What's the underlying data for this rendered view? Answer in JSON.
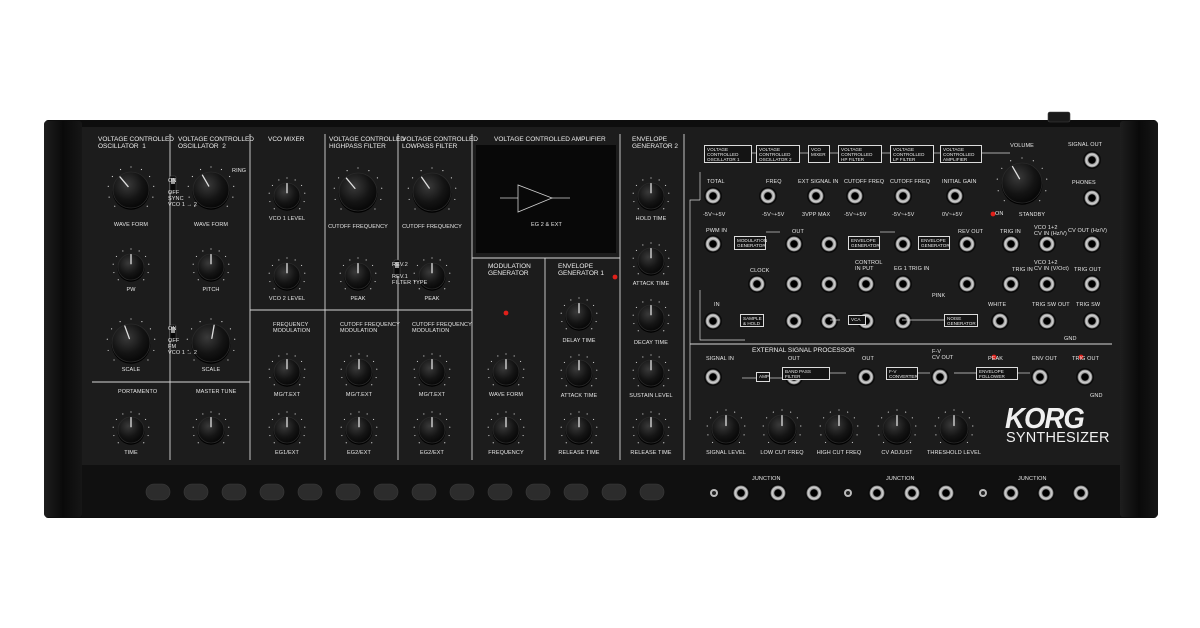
{
  "brand": {
    "logo": "KORG",
    "product": "SYNTHESIZER"
  },
  "sections": {
    "vco1": "VOLTAGE CONTROLLED\nOSCILLATOR  1",
    "vco2": "VOLTAGE CONTROLLED\nOSCILLATOR  2",
    "vco_mixer": "VCO MIXER",
    "hpf": "VOLTAGE CONTROLLED\nHIGHPASS FILTER",
    "lpf": "VOLTAGE CONTROLLED\nLOWPASS FILTER",
    "vca": "VOLTAGE CONTROLLED AMPLIFIER",
    "eg2": "ENVELOPE\nGENERATOR 2",
    "mod_gen": "MODULATION\nGENERATOR",
    "eg1": "ENVELOPE\nGENERATOR 1",
    "freq_mod": "FREQUENCY\nMODULATION",
    "cutoff_mod1": "CUTOFF FREQUENCY\nMODULATION",
    "cutoff_mod2": "CUTOFF FREQUENCY\nMODULATION",
    "esp": "EXTERNAL SIGNAL PROCESSOR",
    "portamento": "PORTAMENTO",
    "master_tune": "MASTER TUNE"
  },
  "knob_labels": {
    "vco1_wave": "WAVE FORM",
    "vco2_wave": "WAVE FORM",
    "pw": "PW",
    "pitch": "PITCH",
    "vco1_scale": "SCALE",
    "vco2_scale": "SCALE",
    "vco1_level": "VCO 1 LEVEL",
    "vco2_level": "VCO 2 LEVEL",
    "hp_cutoff": "CUTOFF FREQUENCY",
    "lp_cutoff": "CUTOFF FREQUENCY",
    "hp_peak": "PEAK",
    "lp_peak": "PEAK",
    "mg_t_ext": "MG/T.EXT",
    "eg1_ext": "EG1/EXT",
    "mg_t_ext2": "MG/T.EXT",
    "eg2_ext": "EG2/EXT",
    "mg_t_ext3": "MG/T.EXT",
    "eg2_ext2": "EG2/EXT",
    "mg_wave": "WAVE FORM",
    "mg_freq": "FREQUENCY",
    "eg1_delay": "DELAY TIME",
    "eg1_attack": "ATTACK TIME",
    "eg1_release": "RELEASE TIME",
    "eg2_hold": "HOLD TIME",
    "eg2_attack": "ATTACK TIME",
    "eg2_decay": "DECAY TIME",
    "eg2_sustain": "SUSTAIN LEVEL",
    "eg2_release": "RELEASE TIME",
    "time": "TIME",
    "volume": "VOLUME",
    "standby": "STANDBY",
    "on": "ON",
    "signal_level": "SIGNAL LEVEL",
    "low_cut": "LOW CUT FREQ",
    "high_cut": "HIGH CUT FREQ",
    "cv_adjust": "CV ADJUST",
    "threshold": "THRESHOLD LEVEL"
  },
  "switch_labels": {
    "vco1_sync": "ON\n\nOFF\nSYNC\nVCO 1 → 2",
    "vco2_ring": "RING",
    "fm": "ON\n\nOFF\nFM\nVCO 1 → 2",
    "rev": "REV.2\n\nREV.1\nFILTER TYPE",
    "vca_mode": "EG 2 & EXT"
  },
  "patch_blocks": [
    "VOLTAGE\nCONTROLLED\nOSCILLATOR 1",
    "VOLTAGE\nCONTROLLED\nOSCILLATOR 2",
    "VCO\nMIXER",
    "VOLTAGE\nCONTROLLED\nHP FILTER",
    "VOLTAGE\nCONTROLLED\nLP FILTER",
    "VOLTAGE\nCONTROLLED\nAMPLIFIER"
  ],
  "patch_labels": {
    "total": "TOTAL",
    "freq": "FREQ",
    "ext_in": "EXT SIGNAL IN",
    "cut1": "CUTOFF FREQ",
    "cut2": "CUTOFF FREQ",
    "gain": "INITIAL GAIN",
    "r1": "-5V~+5V",
    "r2": "-5V~+5V",
    "r3": "3VPP MAX",
    "r4": "-5V~+5V",
    "r5": "-5V~+5V",
    "r6": "0V~+5V",
    "pwm": "PWM IN",
    "modgen": "MODULATION\nGENERATOR",
    "envgen": "ENVELOPE\nGENERATOR",
    "envgen2": "ENVELOPE\nGENERATOR",
    "out": "OUT",
    "rev_out": "REV OUT",
    "trig_in": "TRIG IN",
    "clock": "CLOCK",
    "ctrl": "CONTROL\nIN PUT",
    "eg1_trig": "EG 1 TRIG IN",
    "gnd": "GND",
    "pink": "PINK",
    "white": "WHITE",
    "in": "IN",
    "sh": "SAMPLE\n& HOLD",
    "vca": "VCA",
    "noise": "NOISE\nGENERATOR",
    "trig_in2": "TRIG IN",
    "trig_sw": "TRIG SW OUT",
    "vco12": "VCO 1+2\nCV IN (Hz/V)",
    "vco12b": "VCO 1+2\nCV IN (V/Oct)",
    "cv_out": "CV OUT (Hz/V)",
    "trig_out": "TRIG OUT",
    "trig_sw2": "TRIG SW",
    "sig_out": "SIGNAL OUT",
    "phones": "PHONES"
  },
  "esp_labels": {
    "signal_in": "SIGNAL IN",
    "amp": "AMP",
    "out": "OUT",
    "bpf": "BAND PASS\nFILTER",
    "out2": "OUT",
    "fv": "F-V\nCONVERTER",
    "fv_out": "F-V\nCV OUT",
    "env_f": "ENVELOPE\nFOLLOWER",
    "peak": "PEAK",
    "env_out": "ENV OUT",
    "trig_out": "TRIG OUT",
    "gnd": "GND"
  },
  "junction": "JUNCTION",
  "colors": {
    "panel": "#1b1b1b",
    "chassis": "#0c0c0c",
    "line": "#d8d8d8",
    "knob": "#111111",
    "led": "#e0201a"
  }
}
